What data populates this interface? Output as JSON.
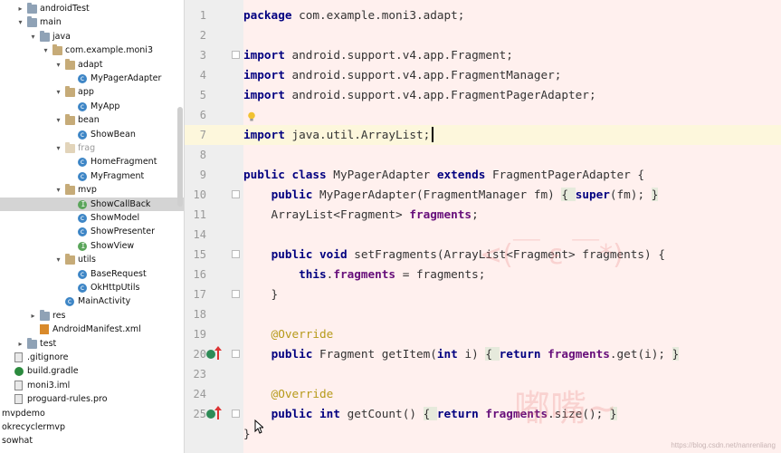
{
  "project_tree": {
    "items": [
      {
        "label": "androidTest",
        "type": "folder",
        "depth": 1,
        "expanded": false
      },
      {
        "label": "main",
        "type": "folder",
        "depth": 1,
        "expanded": true
      },
      {
        "label": "java",
        "type": "folder",
        "depth": 2,
        "expanded": true
      },
      {
        "label": "com.example.moni3",
        "type": "package",
        "depth": 3,
        "expanded": true
      },
      {
        "label": "adapt",
        "type": "package",
        "depth": 4,
        "expanded": true
      },
      {
        "label": "MyPagerAdapter",
        "type": "class",
        "depth": 5
      },
      {
        "label": "app",
        "type": "package",
        "depth": 4,
        "expanded": true
      },
      {
        "label": "MyApp",
        "type": "class",
        "depth": 5
      },
      {
        "label": "bean",
        "type": "package",
        "depth": 4,
        "expanded": true
      },
      {
        "label": "ShowBean",
        "type": "class",
        "depth": 5
      },
      {
        "label": "frag",
        "type": "package",
        "depth": 4,
        "expanded": true,
        "dim": true
      },
      {
        "label": "HomeFragment",
        "type": "class",
        "depth": 5
      },
      {
        "label": "MyFragment",
        "type": "class",
        "depth": 5
      },
      {
        "label": "mvp",
        "type": "package",
        "depth": 4,
        "expanded": true
      },
      {
        "label": "ShowCallBack",
        "type": "interface",
        "depth": 5,
        "selected": true
      },
      {
        "label": "ShowModel",
        "type": "class",
        "depth": 5
      },
      {
        "label": "ShowPresenter",
        "type": "class",
        "depth": 5
      },
      {
        "label": "ShowView",
        "type": "interface",
        "depth": 5
      },
      {
        "label": "utils",
        "type": "package",
        "depth": 4,
        "expanded": true
      },
      {
        "label": "BaseRequest",
        "type": "class",
        "depth": 5
      },
      {
        "label": "OkHttpUtils",
        "type": "class",
        "depth": 5
      },
      {
        "label": "MainActivity",
        "type": "class",
        "depth": 4
      },
      {
        "label": "res",
        "type": "folder",
        "depth": 2,
        "expanded": false
      },
      {
        "label": "AndroidManifest.xml",
        "type": "xml",
        "depth": 2
      },
      {
        "label": "test",
        "type": "folder",
        "depth": 1,
        "expanded": false
      },
      {
        "label": ".gitignore",
        "type": "file",
        "depth": 0
      },
      {
        "label": "build.gradle",
        "type": "gradle",
        "depth": 0
      },
      {
        "label": "moni3.iml",
        "type": "file",
        "depth": 0
      },
      {
        "label": "proguard-rules.pro",
        "type": "file",
        "depth": 0
      },
      {
        "label": "mvpdemo",
        "type": "plain",
        "depth": -1
      },
      {
        "label": "okrecyclermvp",
        "type": "plain",
        "depth": -1
      },
      {
        "label": "sowhat",
        "type": "plain",
        "depth": -1
      }
    ]
  },
  "editor": {
    "current_line": 7,
    "lines": [
      {
        "n": "1",
        "parts": [
          [
            "kw",
            "package"
          ],
          [
            "t",
            " com.example.moni3.adapt;"
          ]
        ]
      },
      {
        "n": "2",
        "parts": []
      },
      {
        "n": "3",
        "parts": [
          [
            "kw",
            "import"
          ],
          [
            "t",
            " android.support.v4.app.Fragment;"
          ]
        ]
      },
      {
        "n": "4",
        "parts": [
          [
            "kw",
            "import"
          ],
          [
            "t",
            " android.support.v4.app.FragmentManager;"
          ]
        ]
      },
      {
        "n": "5",
        "parts": [
          [
            "kw",
            "import"
          ],
          [
            "t",
            " android.support.v4.app.FragmentPagerAdapter;"
          ]
        ]
      },
      {
        "n": "6",
        "parts": []
      },
      {
        "n": "7",
        "parts": [
          [
            "kw",
            "import"
          ],
          [
            "t",
            " java.util.ArrayList;"
          ]
        ]
      },
      {
        "n": "8",
        "parts": []
      },
      {
        "n": "9",
        "parts": [
          [
            "kw",
            "public class"
          ],
          [
            "t",
            " MyPagerAdapter "
          ],
          [
            "kw",
            "extends"
          ],
          [
            "t",
            " FragmentPagerAdapter {"
          ]
        ]
      },
      {
        "n": "10",
        "parts": [
          [
            "t",
            "    "
          ],
          [
            "kw",
            "public"
          ],
          [
            "t",
            " MyPagerAdapter(FragmentManager fm) "
          ],
          [
            "gb",
            "{ "
          ],
          [
            "kw",
            "super"
          ],
          [
            "t",
            "(fm); "
          ],
          [
            "gb",
            "}"
          ]
        ]
      },
      {
        "n": "11",
        "parts": [
          [
            "t",
            "    ArrayList<Fragment> "
          ],
          [
            "fl",
            "fragments"
          ],
          [
            "t",
            ";"
          ]
        ]
      },
      {
        "n": "14",
        "parts": []
      },
      {
        "n": "15",
        "parts": [
          [
            "t",
            "    "
          ],
          [
            "kw",
            "public void"
          ],
          [
            "t",
            " setFragments(ArrayList<Fragment> fragments) {"
          ]
        ]
      },
      {
        "n": "16",
        "parts": [
          [
            "t",
            "        "
          ],
          [
            "kw",
            "this"
          ],
          [
            "t",
            "."
          ],
          [
            "fl",
            "fragments"
          ],
          [
            "t",
            " = fragments;"
          ]
        ]
      },
      {
        "n": "17",
        "parts": [
          [
            "t",
            "    }"
          ]
        ]
      },
      {
        "n": "18",
        "parts": []
      },
      {
        "n": "19",
        "parts": [
          [
            "ann",
            "    @Override"
          ]
        ]
      },
      {
        "n": "20",
        "parts": [
          [
            "t",
            "    "
          ],
          [
            "kw",
            "public"
          ],
          [
            "t",
            " Fragment getItem("
          ],
          [
            "kw",
            "int"
          ],
          [
            "t",
            " i) "
          ],
          [
            "gb",
            "{ "
          ],
          [
            "kw",
            "return"
          ],
          [
            "t",
            " "
          ],
          [
            "fl",
            "fragments"
          ],
          [
            "t",
            ".get(i); "
          ],
          [
            "gb",
            "}"
          ]
        ]
      },
      {
        "n": "23",
        "parts": []
      },
      {
        "n": "24",
        "parts": [
          [
            "ann",
            "    @Override"
          ]
        ]
      },
      {
        "n": "25",
        "parts": [
          [
            "t",
            "    "
          ],
          [
            "kw",
            "public int"
          ],
          [
            "t",
            " getCount() "
          ],
          [
            "gb",
            "{ "
          ],
          [
            "kw",
            "return"
          ],
          [
            "t",
            " "
          ],
          [
            "fl",
            "fragments"
          ],
          [
            "t",
            ".size(); "
          ],
          [
            "gb",
            "}"
          ]
        ]
      },
      {
        "n": "",
        "parts": [
          [
            "t",
            "}"
          ]
        ]
      }
    ]
  },
  "watermark": {
    "emoticon": "<(￣ ε ￣*)",
    "text": "嘟嘴~",
    "footer": "https://blog.csdn.net/nanrenliang"
  },
  "colors": {
    "keyword": "#000080",
    "field": "#660e7a",
    "annotation": "#b69a1a",
    "current_line": "#fdf7dc",
    "editor_bg": "#fff0ee",
    "selected_row": "#d4d4d4"
  }
}
